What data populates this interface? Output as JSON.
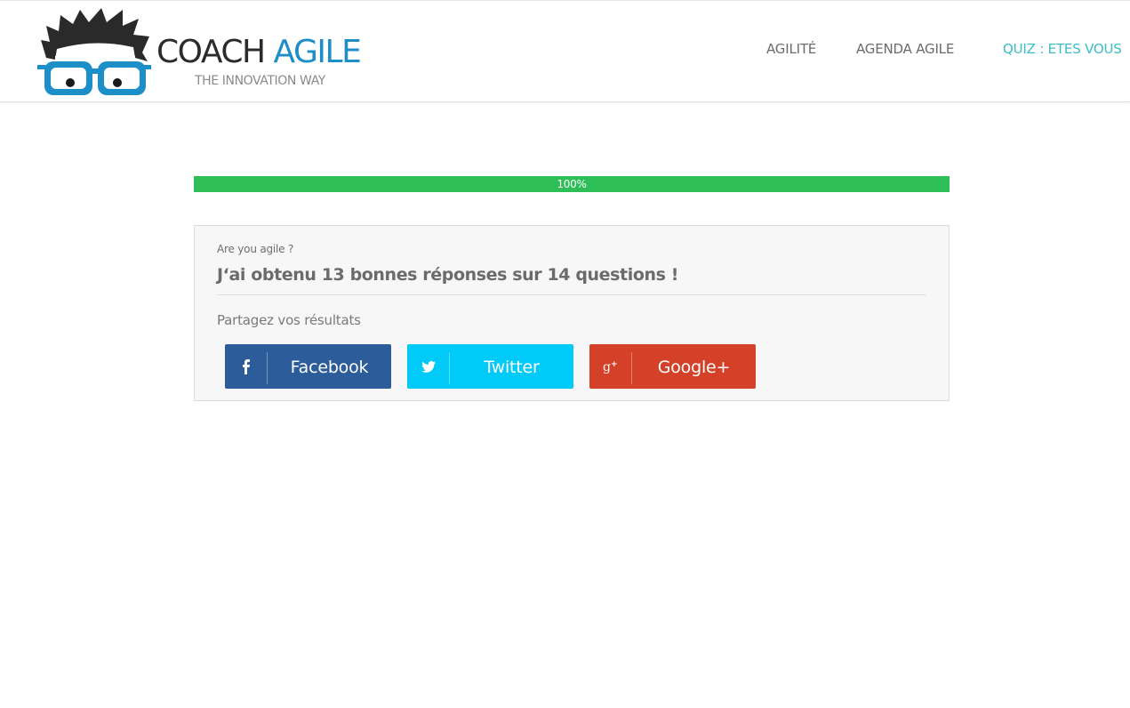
{
  "header": {
    "logo": {
      "title_part1": "COACH",
      "title_part2": "AGILE",
      "tagline": "THE INNOVATION WAY"
    },
    "nav": [
      {
        "label": "AGILITÉ"
      },
      {
        "label": "AGENDA AGILE"
      },
      {
        "label": "QUIZ : ETES VOUS",
        "active": true
      }
    ]
  },
  "progress": {
    "value": 1.0,
    "label": "100%",
    "color": "#2dbe57"
  },
  "result": {
    "quiz_name": "Are you agile ?",
    "text": "J‘ai obtenu 13 bonnes réponses sur 14 questions !",
    "share_label": "Partagez vos résultats",
    "buttons": [
      {
        "label": "Facebook",
        "icon": "facebook-icon",
        "color": "#2c5c9a"
      },
      {
        "label": "Twitter",
        "icon": "twitter-icon",
        "color": "#00cbf8"
      },
      {
        "label": "Google+",
        "icon": "google-plus-icon",
        "color": "#d44128"
      }
    ]
  },
  "colors": {
    "brand_dark": "#2b2b2b",
    "brand_blue": "#1c8fc9",
    "nav_active": "#3bbdc6"
  }
}
